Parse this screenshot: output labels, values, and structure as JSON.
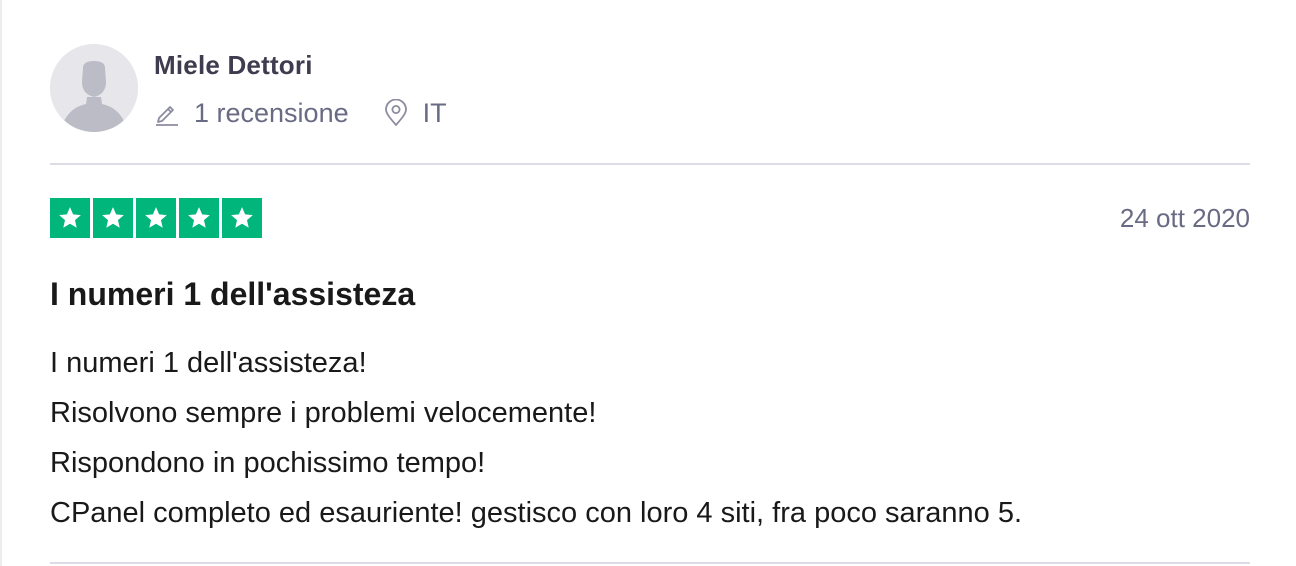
{
  "review": {
    "consumer": {
      "name": "Miele Dettori",
      "reviews_count": "1 recensione",
      "location": "IT",
      "avatar_icon": "default-user-avatar"
    },
    "rating": {
      "stars": 5,
      "max_stars": 5,
      "star_color": "#00b67a"
    },
    "date": "24 ott 2020",
    "title": "I numeri 1 dell'assisteza",
    "body_lines": [
      "I numeri 1 dell'assisteza!",
      "Risolvono sempre i problemi velocemente!",
      "Rispondono in pochissimo tempo!",
      "CPanel completo ed esauriente! gestisco con loro 4 siti, fra poco saranno 5."
    ]
  },
  "icons": {
    "reviews": "pencil-icon",
    "location": "location-pin-icon",
    "star": "star-icon"
  },
  "colors": {
    "text_primary": "#191919",
    "text_muted": "#696a84",
    "divider": "#dcdce6",
    "star_green": "#00b67a",
    "avatar_bg": "#e6e6eb"
  }
}
